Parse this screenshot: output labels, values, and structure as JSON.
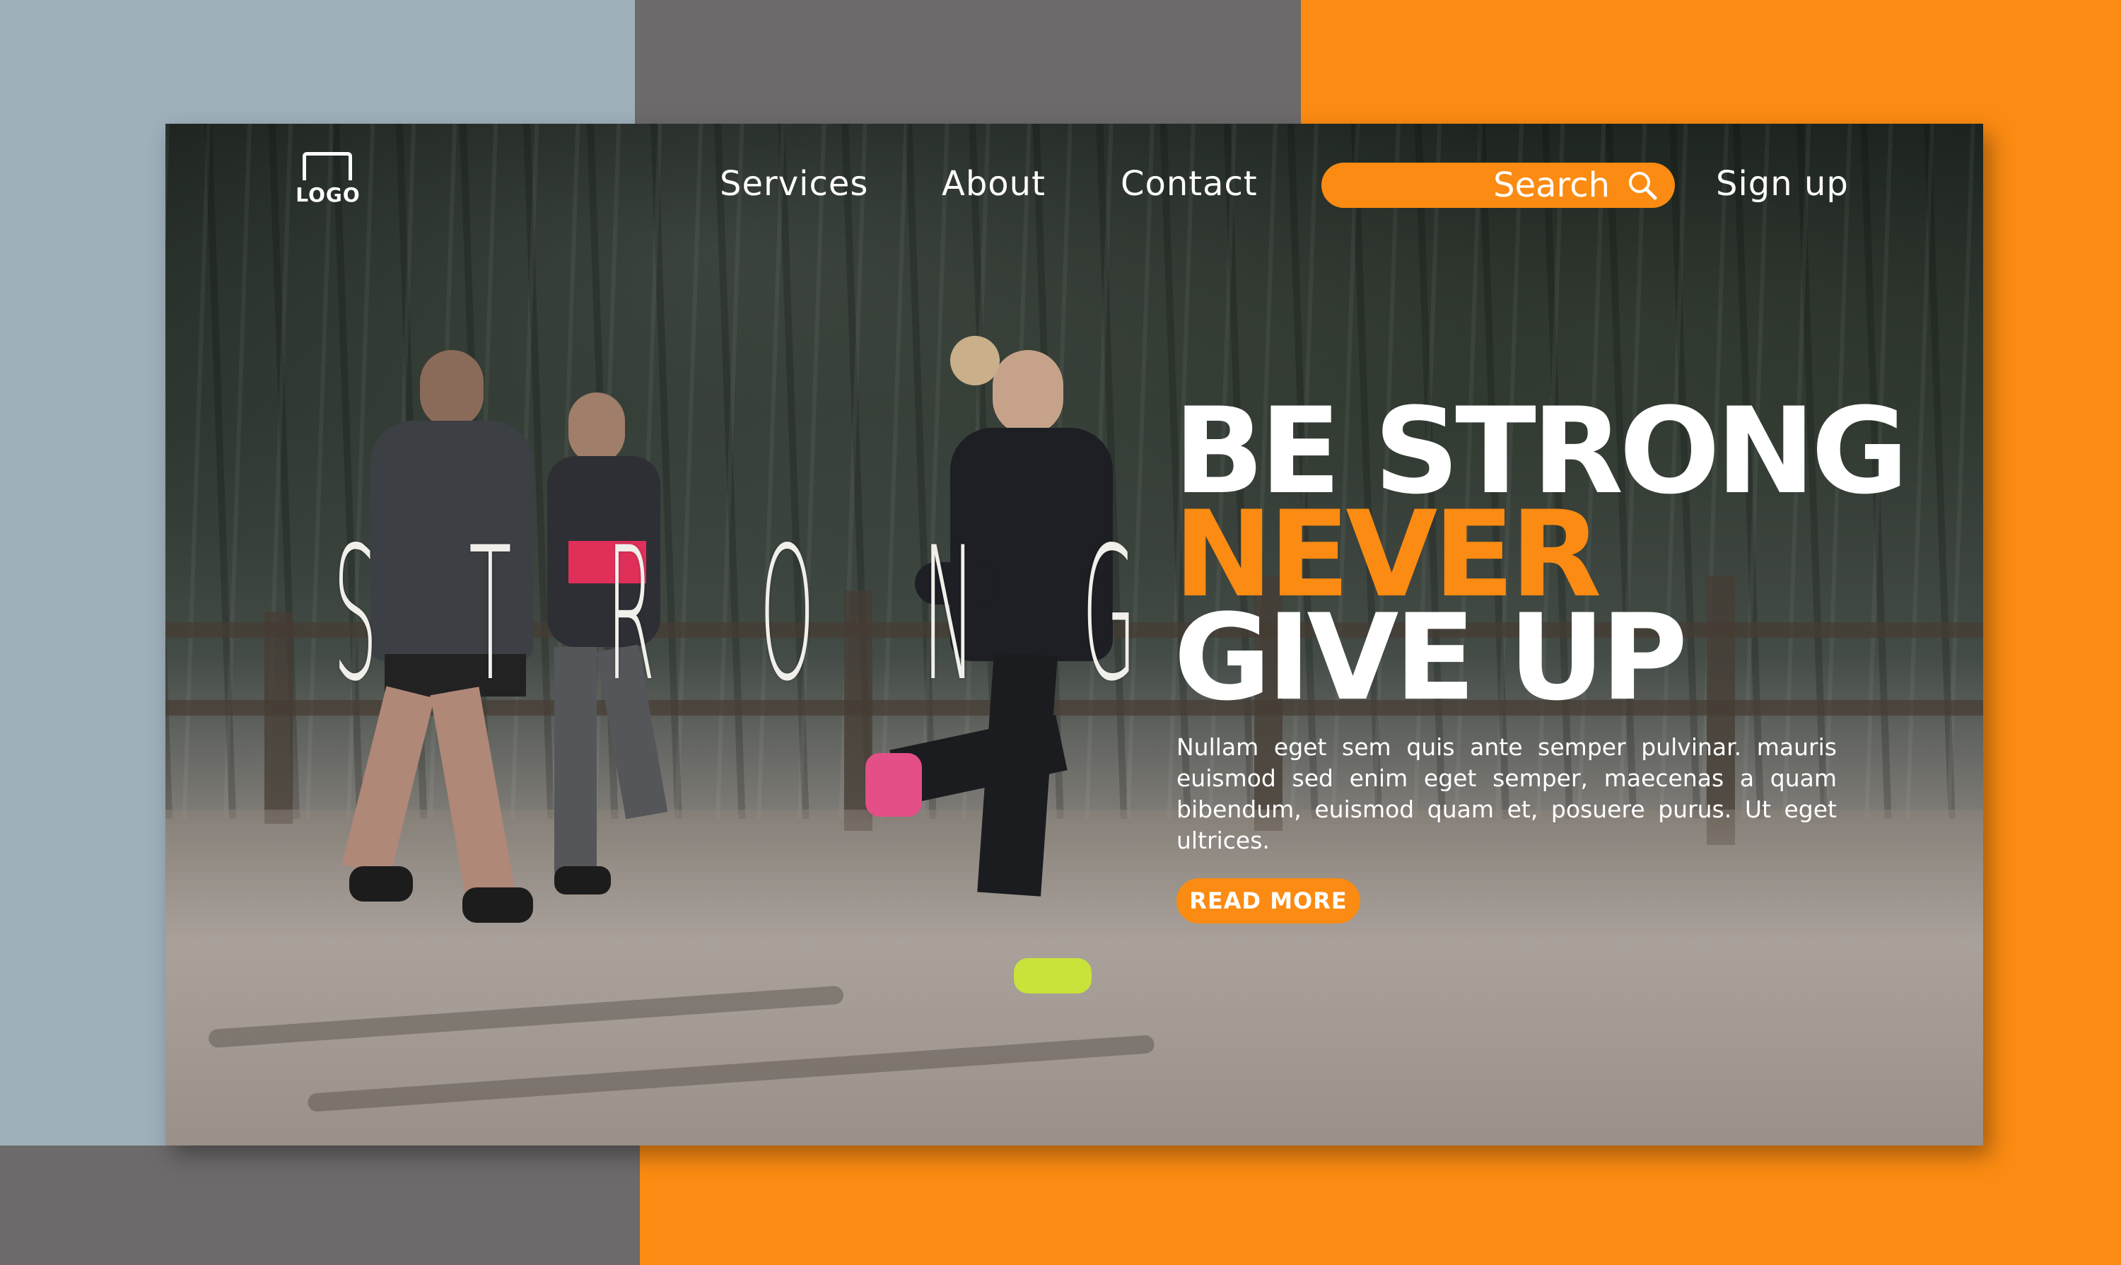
{
  "nav": {
    "logo_text": "LOGO",
    "links": [
      "Services",
      "About",
      "Contact"
    ],
    "search_label": "Search",
    "signup_label": "Sign up"
  },
  "hero": {
    "big_word_letters": [
      "S",
      "T",
      "R",
      "O",
      "N",
      "G"
    ],
    "headline_line1": "BE STRONG",
    "headline_line2": "NEVER",
    "headline_line3": "GIVE  UP",
    "body": "Nullam eget sem quis ante semper pulvinar. mauris euismod sed enim eget semper, maecenas a quam bibendum, euismod quam et, posuere purus. Ut eget ultrices.",
    "cta_label": "READ MORE"
  },
  "colors": {
    "accent": "#fb8b12",
    "slate_blue": "#9fb0bb",
    "gray": "#6d6a6b",
    "text": "#ffffff"
  },
  "icons": {
    "logo": "weightlifter-logo-icon",
    "search": "search-icon"
  }
}
